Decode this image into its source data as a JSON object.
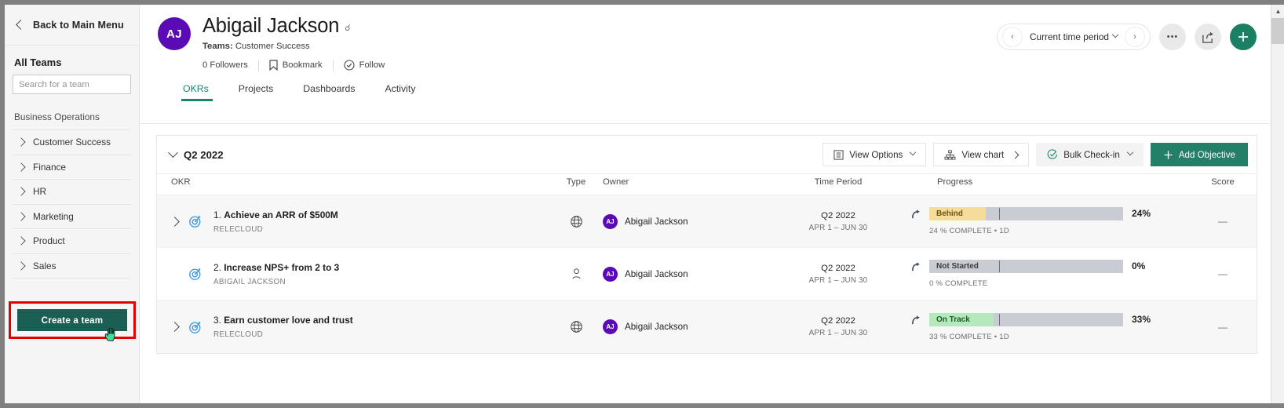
{
  "sidebar": {
    "back_label": "Back to Main Menu",
    "back_icon": "chevron-left-icon",
    "all_teams_label": "All Teams",
    "search_placeholder": "Search for a team",
    "search_value": "",
    "group_label": "Business Operations",
    "teams": [
      {
        "name": "Customer Success"
      },
      {
        "name": "Finance"
      },
      {
        "name": "HR"
      },
      {
        "name": "Marketing"
      },
      {
        "name": "Product"
      },
      {
        "name": "Sales"
      }
    ],
    "create_team_label": "Create a team",
    "highlight_color": "#e50000",
    "create_team_color": "#1b5e54"
  },
  "profile": {
    "avatar_initials": "AJ",
    "avatar_color": "#5b0bb5",
    "name": "Abigail Jackson",
    "link_icon": "link-icon",
    "teams_label": "Teams:",
    "teams_value": "Customer Success",
    "followers": "0 Followers",
    "bookmark_label": "Bookmark",
    "follow_label": "Follow"
  },
  "tabs": [
    {
      "label": "OKRs",
      "active": true
    },
    {
      "label": "Projects",
      "active": false
    },
    {
      "label": "Dashboards",
      "active": false
    },
    {
      "label": "Activity",
      "active": false
    }
  ],
  "header_controls": {
    "prev_label": "‹",
    "period_label": "Current time period",
    "next_label": "›",
    "more_label": "•••",
    "share_icon": "share-icon",
    "add_icon": "plus-icon",
    "accent_green": "#1a7f63"
  },
  "card_toolbar": {
    "period_title": "Q2 2022",
    "view_options_label": "View Options",
    "view_chart_label": "View chart",
    "bulk_checkin_label": "Bulk Check-in",
    "add_objective_label": "Add Objective"
  },
  "table": {
    "columns": [
      "OKR",
      "Type",
      "Owner",
      "Time Period",
      "Progress",
      "Score"
    ],
    "rows": [
      {
        "expandable": true,
        "index": "1.",
        "title": "Achieve an ARR of $500M",
        "subtitle": "RELECLOUD",
        "type_icon": "globe-icon",
        "owner": "Abigail Jackson",
        "owner_initials": "AJ",
        "period": "Q2 2022",
        "period_range": "APR 1 – JUN 30",
        "status": "Behind",
        "status_color": "#f5dc9a",
        "status_text_color": "#6b5410",
        "percent": 24,
        "percent_label": "24%",
        "progress_note": "24 % COMPLETE • 1D",
        "score": "—"
      },
      {
        "expandable": false,
        "index": "2.",
        "title": "Increase NPS+ from 2 to 3",
        "subtitle": "ABIGAIL JACKSON",
        "type_icon": "person-icon",
        "owner": "Abigail Jackson",
        "owner_initials": "AJ",
        "period": "Q2 2022",
        "period_range": "APR 1 – JUN 30",
        "status": "Not Started",
        "status_color": "#c9ccd3",
        "status_text_color": "#3b3b3b",
        "percent": 0,
        "percent_label": "0%",
        "progress_note": "0 % COMPLETE",
        "score": "—"
      },
      {
        "expandable": true,
        "index": "3.",
        "title": "Earn customer love and trust",
        "subtitle": "RELECLOUD",
        "type_icon": "globe-icon",
        "owner": "Abigail Jackson",
        "owner_initials": "AJ",
        "period": "Q2 2022",
        "period_range": "APR 1 – JUN 30",
        "status": "On Track",
        "status_color": "#b5e8bc",
        "status_text_color": "#1d5c28",
        "percent": 33,
        "percent_label": "33%",
        "progress_note": "33 % COMPLETE • 1D",
        "score": "—"
      }
    ]
  },
  "scrollbar": {
    "up_arrow": "▲"
  }
}
